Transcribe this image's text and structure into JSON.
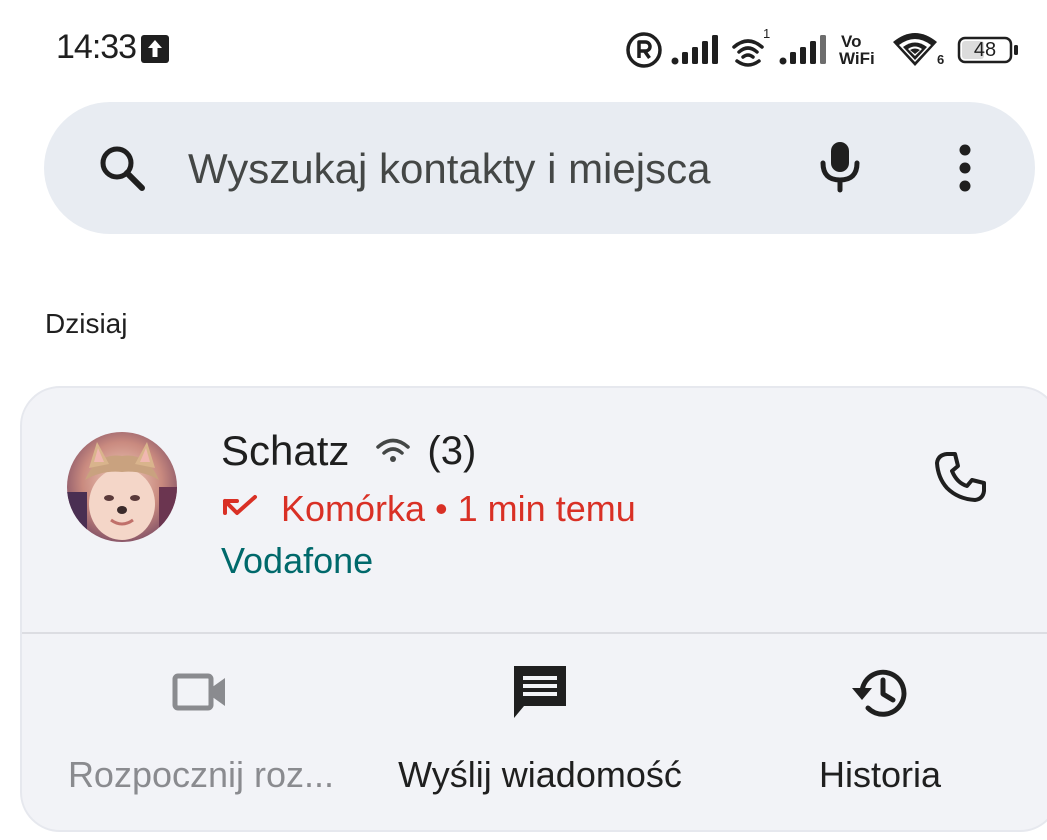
{
  "status_bar": {
    "time": "14:33",
    "battery_level": "48",
    "icons": [
      "upload-icon",
      "registered-icon",
      "signal-icon",
      "wifi-calling-icon",
      "signal-icon",
      "vowifi-icon",
      "wifi-icon",
      "battery-icon"
    ],
    "wifi_sup": "1",
    "wifi6_label": "6",
    "vowifi_vo": "Vo",
    "vowifi_wifi": "WiFi"
  },
  "search": {
    "placeholder": "Wyszukaj kontakty i miejsca"
  },
  "section": {
    "label": "Dzisiaj"
  },
  "call_entry": {
    "name": "Schatz",
    "count": "(3)",
    "detail": "Komórka • 1 min temu",
    "carrier": "Vodafone",
    "call_type": "missed-call-icon"
  },
  "actions": [
    {
      "label": "Rozpocznij roz...",
      "icon": "video-call-icon",
      "enabled": false
    },
    {
      "label": "Wyślij wiadomość",
      "icon": "message-icon",
      "enabled": true
    },
    {
      "label": "Historia",
      "icon": "history-icon",
      "enabled": true
    }
  ],
  "colors": {
    "search_bg": "#e8ecf2",
    "card_bg": "#f2f3f7",
    "missed_red": "#d93025",
    "carrier_teal": "#00696b",
    "disabled_gray": "#8a8b8f"
  }
}
